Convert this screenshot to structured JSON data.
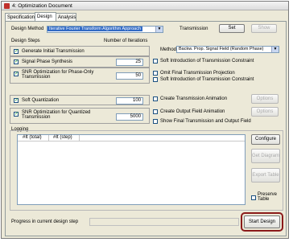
{
  "window": {
    "title": "4: Optimization Document"
  },
  "tabs": [
    {
      "label": "Specification"
    },
    {
      "label": "Design"
    },
    {
      "label": "Analysis"
    }
  ],
  "design_method": {
    "label": "Design Method",
    "value": "Iterative Fourier Transform Algorithm Approach",
    "transmission_label": "Transmission",
    "set_button": "Set",
    "show_button": "Show"
  },
  "columns": {
    "design_steps": "Design Steps",
    "number_of_iterations": "Number of Iterations"
  },
  "steps": [
    {
      "label": "Generate Initial Transmission",
      "checked": true
    },
    {
      "label": "Signal Phase Synthesis",
      "checked": true,
      "iterations": "25"
    },
    {
      "label": "SNR Optimization for Phase-Only Transmission",
      "checked": true,
      "iterations": "50"
    },
    {
      "label": "Soft Quantization",
      "checked": true,
      "iterations": "100"
    },
    {
      "label": "SNR Optimization for Quantized Transmission",
      "checked": true,
      "iterations": "5000"
    }
  ],
  "method": {
    "label": "Method",
    "value": "Backw. Prop. Signal Field (Random Phase)"
  },
  "options_right": [
    {
      "label": "Soft Introduction of Transmission Constraint",
      "checked": false
    },
    {
      "label": "Omit Final Transmission Projection",
      "checked": false
    },
    {
      "label": "Soft Introduction of Transmission Constraint",
      "checked": false
    },
    {
      "label": "Create Transmission Animation",
      "checked": false
    },
    {
      "label": "Create Output Field Animation",
      "checked": false
    },
    {
      "label": "Show Final Transmission and Output Field",
      "checked": false
    }
  ],
  "options_buttons": {
    "first": "Options",
    "second": "Options"
  },
  "logging": {
    "label": "Logging",
    "columns": [
      "#It (total)",
      "#It (step)"
    ],
    "buttons": {
      "configure": "Configure",
      "get_diagram": "Get Diagram",
      "export_table": "Export Table"
    },
    "preserve_table": "Preserve Table"
  },
  "status": {
    "progress_label": "Progress in current design step"
  },
  "start_button": "Start Design"
}
